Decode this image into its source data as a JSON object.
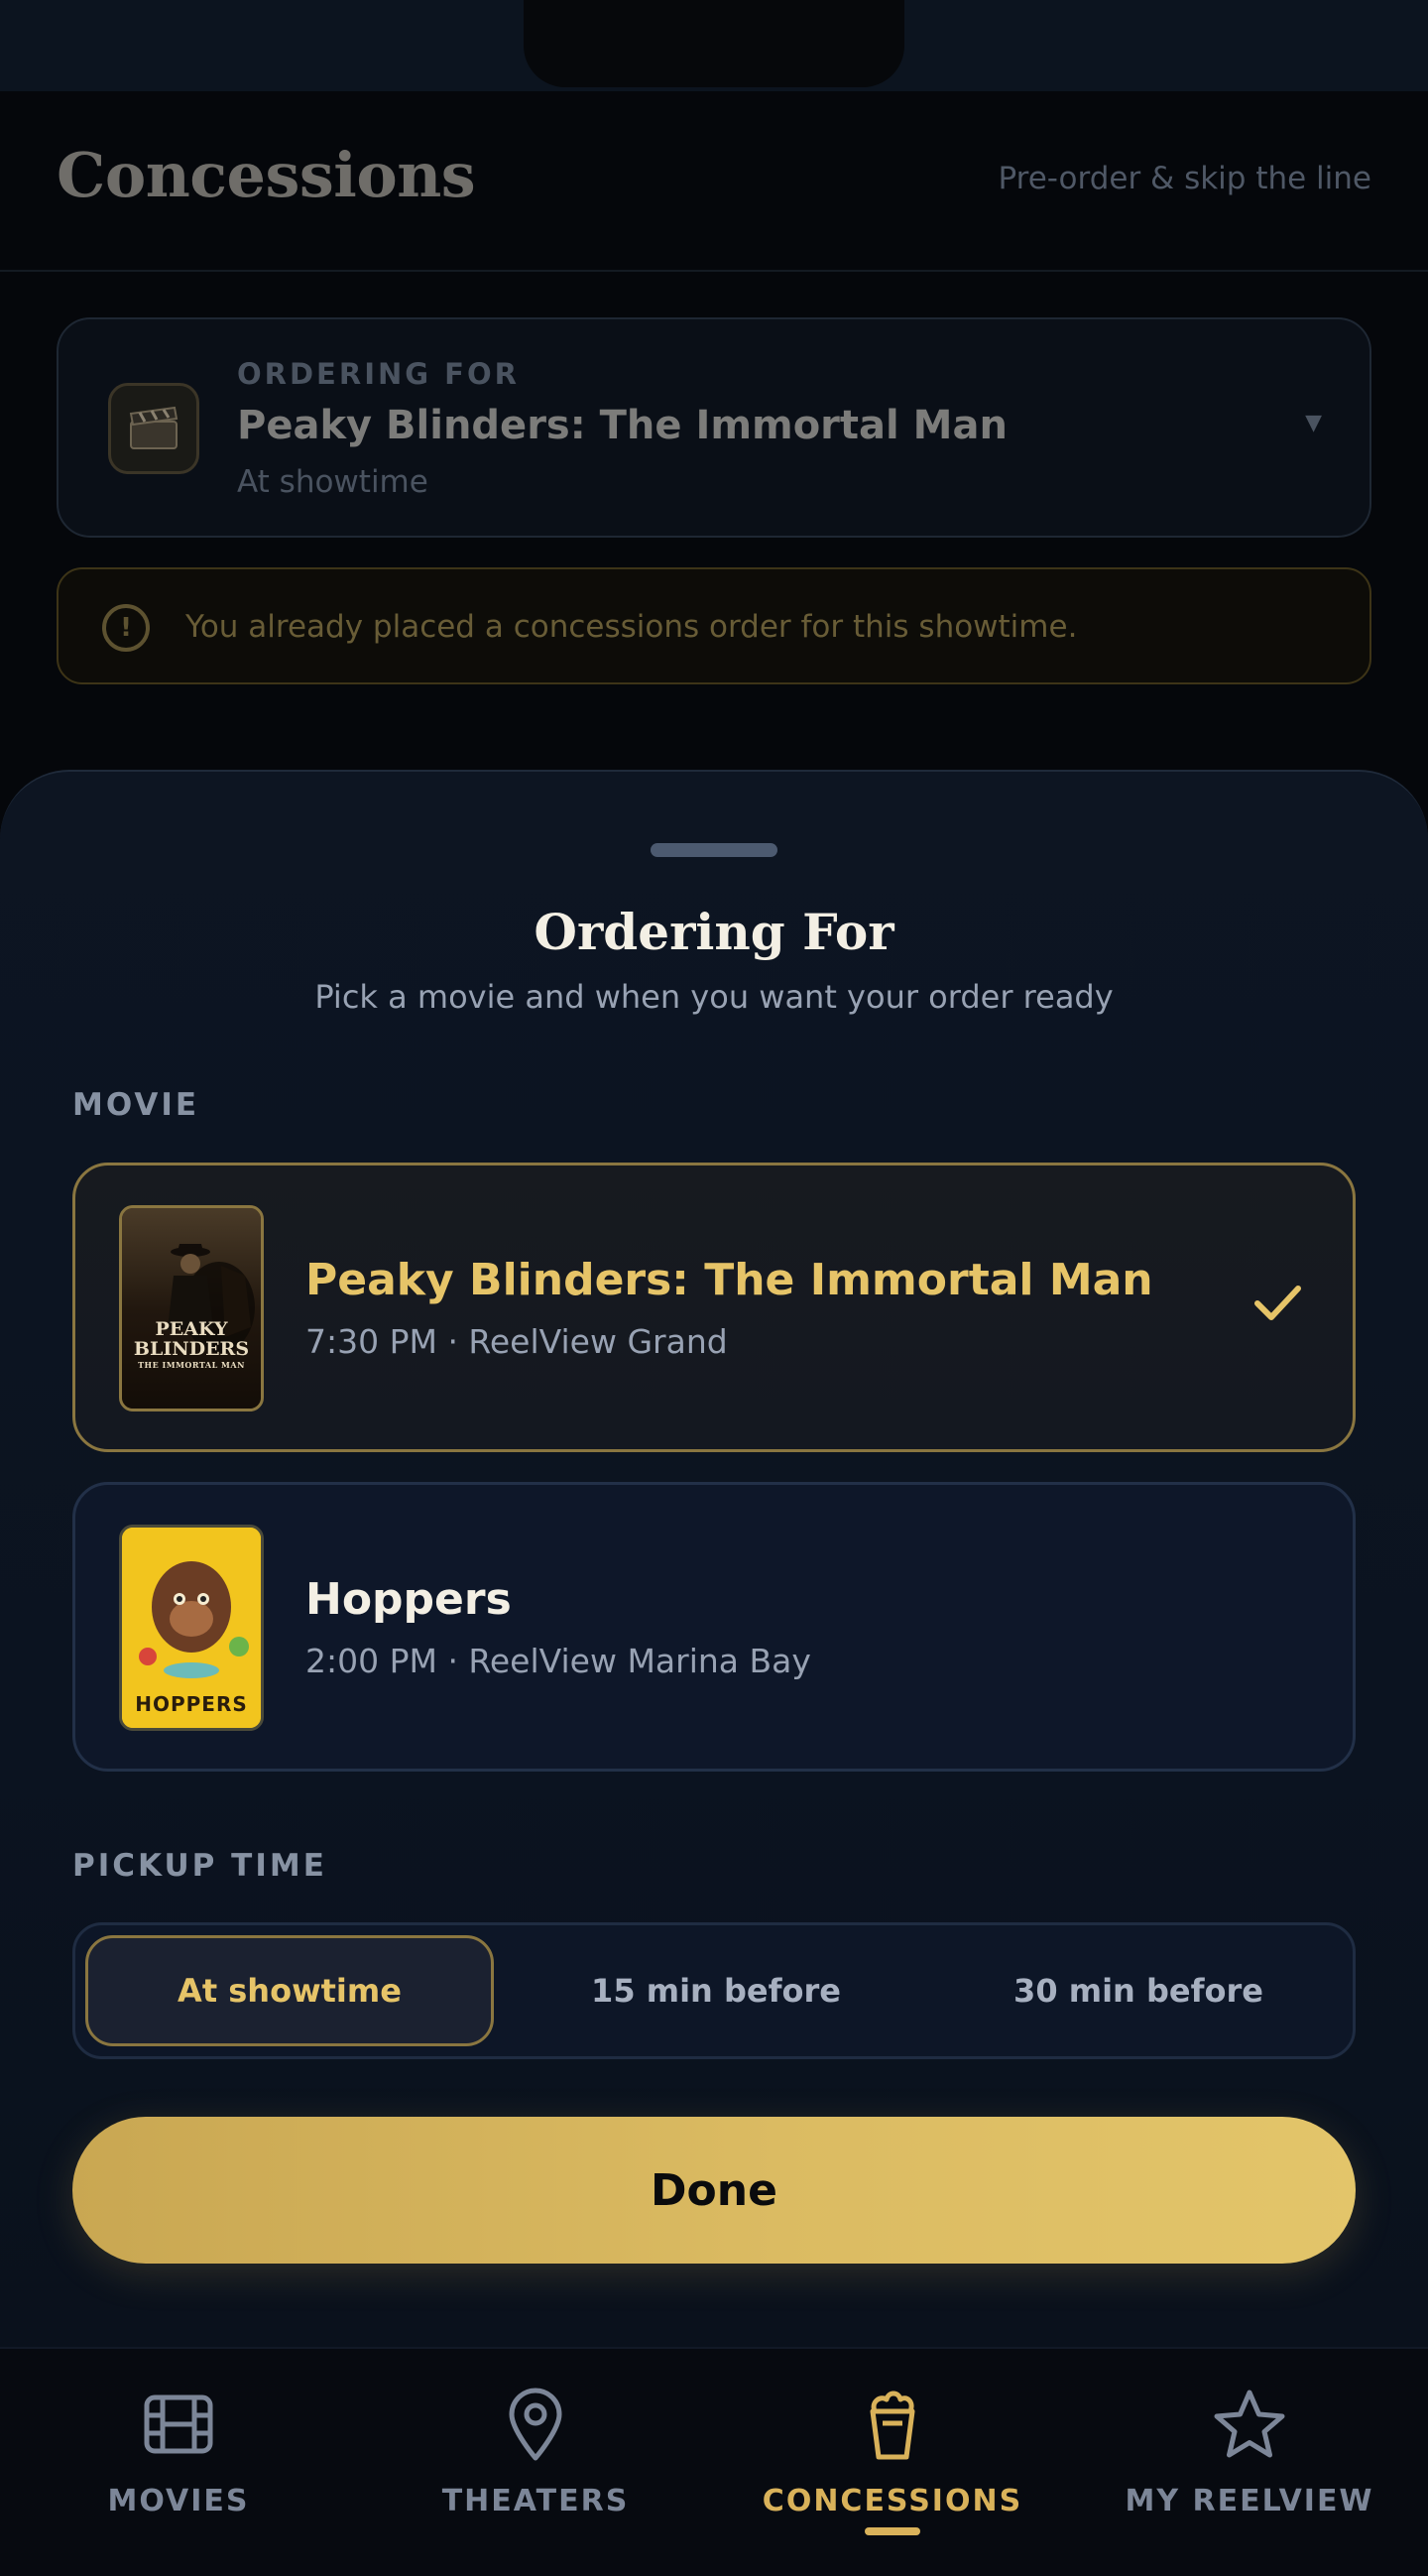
{
  "header": {
    "title": "Concessions",
    "subtitle": "Pre-order & skip the line"
  },
  "order_card": {
    "eyebrow": "ORDERING FOR",
    "movie": "Peaky Blinders: The Immortal Man",
    "timing": "At showtime",
    "icon": "clapperboard-icon"
  },
  "alert": {
    "text": "You already placed a concessions order for this showtime.",
    "icon": "exclamation-circle-icon"
  },
  "sheet": {
    "title": "Ordering For",
    "subtitle": "Pick a movie and when you want your order ready",
    "movie_label": "MOVIE",
    "movies": [
      {
        "title": "Peaky Blinders: The Immortal Man",
        "meta": "7:30 PM · ReelView Grand",
        "poster_text": [
          "PEAKY",
          "BLINDERS",
          "THE IMMORTAL MAN"
        ],
        "selected": true
      },
      {
        "title": "Hoppers",
        "meta": "2:00 PM · ReelView Marina Bay",
        "poster_text": [
          "HOPPERS"
        ],
        "selected": false
      }
    ],
    "pickup_label": "PICKUP TIME",
    "pickup_options": [
      "At showtime",
      "15 min before",
      "30 min before"
    ],
    "pickup_selected": "At showtime",
    "done_label": "Done"
  },
  "nav": {
    "items": [
      {
        "label": "MOVIES",
        "icon": "film-icon"
      },
      {
        "label": "THEATERS",
        "icon": "map-pin-icon"
      },
      {
        "label": "CONCESSIONS",
        "icon": "popcorn-icon",
        "active": true
      },
      {
        "label": "MY REELVIEW",
        "icon": "star-icon"
      }
    ]
  },
  "colors": {
    "accent": "#d9b25a",
    "accent_light": "#e6c468",
    "background": "#05070b",
    "sheet": "#0d1522"
  }
}
